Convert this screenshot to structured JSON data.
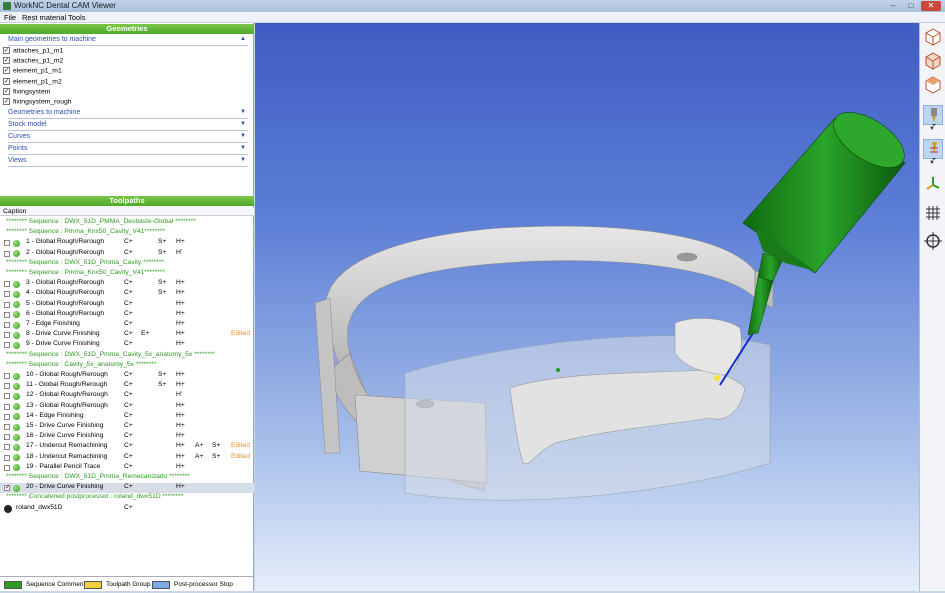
{
  "window": {
    "title": "WorkNC Dental CAM Viewer",
    "controls": [
      "–",
      "□",
      "✕"
    ]
  },
  "menu": [
    "File",
    "Rest material",
    "Tools"
  ],
  "geometries": {
    "header": "Geometries",
    "main_section": "Main geometries to machine",
    "items": [
      "attaches_p1_m1",
      "attaches_p1_m2",
      "element_p1_m1",
      "element_p1_m2",
      "fixingsystem",
      "fixingsystem_rough"
    ],
    "sections": [
      "Geometries to machine",
      "Stock model",
      "Curves",
      "Points",
      "Views"
    ]
  },
  "toolpaths": {
    "header": "Toolpaths",
    "caption_col": "Caption",
    "rows": [
      {
        "kind": "seq",
        "text": "******** Sequence : DWX_51D_PMMA_Desbaste-Global ********"
      },
      {
        "kind": "seq",
        "text": "******** Sequence : Pmma_Knx50_Cavity_V41********"
      },
      {
        "kind": "tp",
        "name": "1 - Global Rough/Rerough",
        "c": "C+",
        "e": "",
        "s": "S+",
        "h": "H+",
        "a": "",
        "s2": "",
        "ed": ""
      },
      {
        "kind": "tp",
        "name": "2 - Global Rough/Rerough",
        "c": "C+",
        "e": "",
        "s": "S+",
        "h": "H'",
        "a": "",
        "s2": "",
        "ed": ""
      },
      {
        "kind": "seq",
        "text": "******** Sequence : DWX_51D_Pmma_Cavity ********"
      },
      {
        "kind": "seq",
        "text": "******** Sequence : Pmma_Knx50_Cavity_V41********"
      },
      {
        "kind": "tp",
        "name": "3 - Global Rough/Rerough",
        "c": "C+",
        "e": "",
        "s": "S+",
        "h": "H+",
        "a": "",
        "s2": "",
        "ed": ""
      },
      {
        "kind": "tp",
        "name": "4 - Global Rough/Rerough",
        "c": "C+",
        "e": "",
        "s": "S+",
        "h": "H+",
        "a": "",
        "s2": "",
        "ed": ""
      },
      {
        "kind": "tp",
        "name": "5 - Global Rough/Rerough",
        "c": "C+",
        "e": "",
        "s": "",
        "h": "H+",
        "a": "",
        "s2": "",
        "ed": ""
      },
      {
        "kind": "tp",
        "name": "6 - Global Rough/Rerough",
        "c": "C+",
        "e": "",
        "s": "",
        "h": "H+",
        "a": "",
        "s2": "",
        "ed": ""
      },
      {
        "kind": "tp",
        "name": "7 - Edge Finishing",
        "c": "C+",
        "e": "",
        "s": "",
        "h": "H+",
        "a": "",
        "s2": "",
        "ed": ""
      },
      {
        "kind": "tp",
        "name": "8 - Drive Curve Finishing",
        "c": "C+",
        "e": "E+",
        "s": "",
        "h": "H+",
        "a": "",
        "s2": "",
        "ed": "Edited"
      },
      {
        "kind": "tp",
        "name": "9 - Drive Curve Finishing",
        "c": "C+",
        "e": "",
        "s": "",
        "h": "H+",
        "a": "",
        "s2": "",
        "ed": ""
      },
      {
        "kind": "seq",
        "text": "******** Sequence : DWX_51D_Pmma_Cavity_5x_anatomy_5x ********"
      },
      {
        "kind": "seq",
        "text": "******** Sequence : Cavity_5x_anatomy_5x ********"
      },
      {
        "kind": "tp",
        "name": "10 - Global Rough/Rerough",
        "c": "C+",
        "e": "",
        "s": "S+",
        "h": "H+",
        "a": "",
        "s2": "",
        "ed": ""
      },
      {
        "kind": "tp",
        "name": "11 - Global Rough/Rerough",
        "c": "C+",
        "e": "",
        "s": "S+",
        "h": "H+",
        "a": "",
        "s2": "",
        "ed": ""
      },
      {
        "kind": "tp",
        "name": "12 - Global Rough/Rerough",
        "c": "C+",
        "e": "",
        "s": "",
        "h": "H'",
        "a": "",
        "s2": "",
        "ed": ""
      },
      {
        "kind": "tp",
        "name": "13 - Global Rough/Rerough",
        "c": "C+",
        "e": "",
        "s": "",
        "h": "H+",
        "a": "",
        "s2": "",
        "ed": ""
      },
      {
        "kind": "tp",
        "name": "14 - Edge Finishing",
        "c": "C+",
        "e": "",
        "s": "",
        "h": "H+",
        "a": "",
        "s2": "",
        "ed": ""
      },
      {
        "kind": "tp",
        "name": "15 - Drive Curve Finishing",
        "c": "C+",
        "e": "",
        "s": "",
        "h": "H+",
        "a": "",
        "s2": "",
        "ed": ""
      },
      {
        "kind": "tp",
        "name": "16 - Drive Curve Finishing",
        "c": "C+",
        "e": "",
        "s": "",
        "h": "H+",
        "a": "",
        "s2": "",
        "ed": ""
      },
      {
        "kind": "tp",
        "name": "17 - Undercut Remachining",
        "c": "C+",
        "e": "",
        "s": "",
        "h": "H+",
        "a": "A+",
        "s2": "S+",
        "ed": "Edited"
      },
      {
        "kind": "tp",
        "name": "18 - Undercut Remachining",
        "c": "C+",
        "e": "",
        "s": "",
        "h": "H+",
        "a": "A+",
        "s2": "S+",
        "ed": "Edited"
      },
      {
        "kind": "tp",
        "name": "19 - Parallel Pencil Trace",
        "c": "C+",
        "e": "",
        "s": "",
        "h": "H+",
        "a": "",
        "s2": "",
        "ed": ""
      },
      {
        "kind": "seq",
        "text": "******** Sequence : DWX_51D_Pmma_Remecanizado ********"
      },
      {
        "kind": "tp",
        "name": "20 - Drive Curve Finishing",
        "c": "C+",
        "e": "",
        "s": "",
        "h": "H+",
        "a": "",
        "s2": "",
        "ed": "",
        "selected": true
      },
      {
        "kind": "seq",
        "text": "******** Concatened postprocessor : roland_dwx51D ********"
      },
      {
        "kind": "pp",
        "name": "roland_dwx51D",
        "c": "C+"
      }
    ]
  },
  "legend": [
    {
      "label": "Sequence Comment",
      "color": "#2e9a22"
    },
    {
      "label": "Toolpath Group",
      "color": "#f0d040"
    },
    {
      "label": "Post-processor Stop",
      "color": "#7aa8e8"
    }
  ],
  "toolbar_icons": [
    "cube-front-icon",
    "cube-iso-icon",
    "cube-top-icon",
    "tool-view-icon",
    "toolpath-view-icon",
    "axis-icon",
    "grid-icon",
    "target-icon"
  ],
  "colors": {
    "accent_green": "#4ea82a",
    "tool_green": "#1f8f1a",
    "model_grey": "#c8c8c8"
  }
}
